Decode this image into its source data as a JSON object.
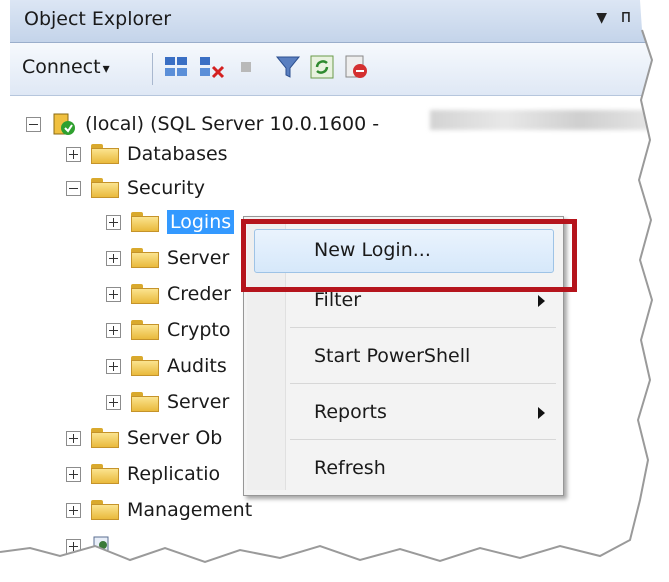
{
  "window": {
    "title": "Object Explorer",
    "pin": "↓ ᴨ"
  },
  "toolbar": {
    "connect_label": "Connect",
    "connect_arrow": "▾"
  },
  "tree": {
    "server": "(local) (SQL Server 10.0.1600 -",
    "databases": "Databases",
    "security": "Security",
    "logins": "Logins",
    "server_roles": "Server",
    "credentials": "Creder",
    "cryptographic": "Crypto",
    "audits": "Audits",
    "server_audit_specs": "Server",
    "server_objects": "Server Ob",
    "replication": "Replicatio",
    "management": "Management"
  },
  "context_menu": {
    "items": [
      "New Login...",
      "Filter",
      "Start PowerShell",
      "Reports",
      "Refresh"
    ]
  }
}
